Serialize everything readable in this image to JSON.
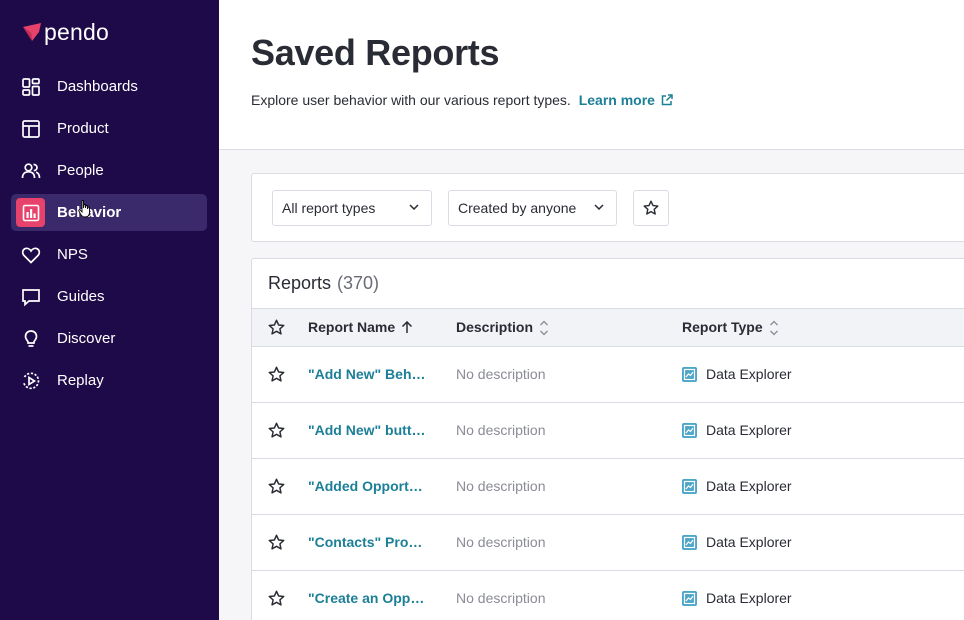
{
  "brand": {
    "name": "pendo"
  },
  "sidebar": {
    "items": [
      {
        "label": "Dashboards",
        "icon": "dashboards-icon"
      },
      {
        "label": "Product",
        "icon": "product-icon"
      },
      {
        "label": "People",
        "icon": "people-icon"
      },
      {
        "label": "Behavior",
        "icon": "behavior-icon",
        "active": true
      },
      {
        "label": "NPS",
        "icon": "heart-icon"
      },
      {
        "label": "Guides",
        "icon": "guides-icon"
      },
      {
        "label": "Discover",
        "icon": "lightbulb-icon"
      },
      {
        "label": "Replay",
        "icon": "replay-icon"
      }
    ]
  },
  "header": {
    "title": "Saved Reports",
    "subtitle": "Explore user behavior with our various report types.",
    "learn_more": "Learn more"
  },
  "filters": {
    "report_types": "All report types",
    "created_by": "Created by anyone"
  },
  "reports": {
    "title": "Reports",
    "count": "(370)",
    "columns": {
      "name": "Report Name",
      "description": "Description",
      "type": "Report Type"
    },
    "rows": [
      {
        "name": "\"Add New\" Behavior",
        "description": "No description",
        "type": "Data Explorer"
      },
      {
        "name": "\"Add New\" button clicks",
        "description": "No description",
        "type": "Data Explorer"
      },
      {
        "name": "\"Added Opportunity\"",
        "description": "No description",
        "type": "Data Explorer"
      },
      {
        "name": "\"Contacts\" Product",
        "description": "No description",
        "type": "Data Explorer"
      },
      {
        "name": "\"Create an Opportunity\"",
        "description": "No description",
        "type": "Data Explorer"
      }
    ]
  },
  "colors": {
    "sidebar_bg": "#1e0a48",
    "active_bg": "#3b2a6b",
    "brand_accent": "#e7426b",
    "link": "#1c7f98"
  }
}
